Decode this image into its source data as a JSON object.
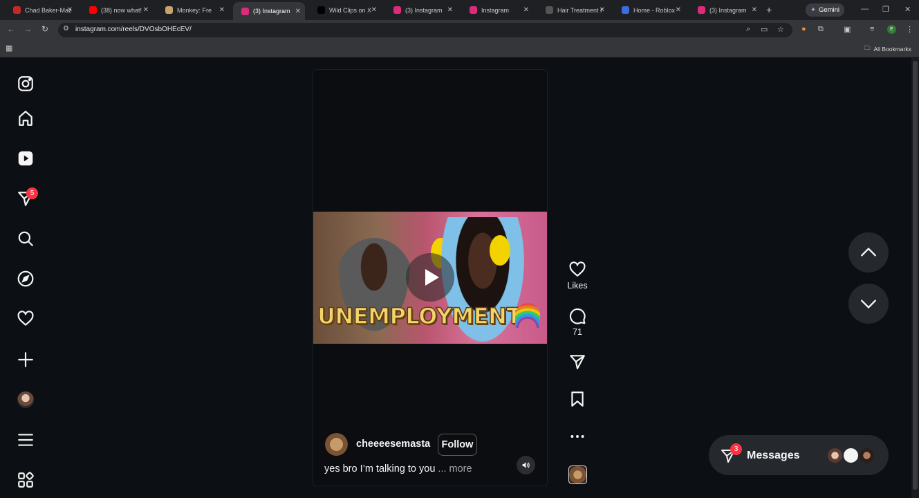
{
  "browser": {
    "tabs": [
      {
        "label": "Chad Baker-Maz",
        "favicon_color": "#c62828",
        "active": false
      },
      {
        "label": "(38) now what!",
        "favicon_color": "#ff0000",
        "active": false
      },
      {
        "label": "Monkey: Fre",
        "favicon_color": "#c9a36a",
        "active": false
      },
      {
        "label": "(3) Instagram",
        "favicon_color": "#dd2a7b",
        "active": true
      },
      {
        "label": "Wild Clips on X",
        "favicon_color": "#000000",
        "active": false
      },
      {
        "label": "(3) Instagram",
        "favicon_color": "#dd2a7b",
        "active": false
      },
      {
        "label": "Instagram",
        "favicon_color": "#dd2a7b",
        "active": false
      },
      {
        "label": "Hair Treatment I",
        "favicon_color": "#555555",
        "active": false
      },
      {
        "label": "Home - Roblox",
        "favicon_color": "#3d6be0",
        "active": false
      },
      {
        "label": "(3) Instagram",
        "favicon_color": "#dd2a7b",
        "active": false
      }
    ],
    "new_tab": "+",
    "gemini_label": "Gemini",
    "url": "instagram.com/reels/DVOsbOHEcEV/",
    "profile_initial": "E",
    "all_bookmarks": "All Bookmarks"
  },
  "sidebar": {
    "messages_badge": "5"
  },
  "reel": {
    "video_caption_word": "UNEMPLOYMENT",
    "author": "cheeeesemasta",
    "follow_label": "Follow",
    "caption_text": "yes bro I’m talking to you",
    "caption_more": "... more"
  },
  "actions": {
    "likes_label": "Likes",
    "comments_count": "71"
  },
  "messages": {
    "label": "Messages",
    "badge": "3"
  },
  "colors": {
    "page_bg": "#0c1014",
    "badge_red": "#ff3040",
    "pill_bg": "#25292e"
  }
}
